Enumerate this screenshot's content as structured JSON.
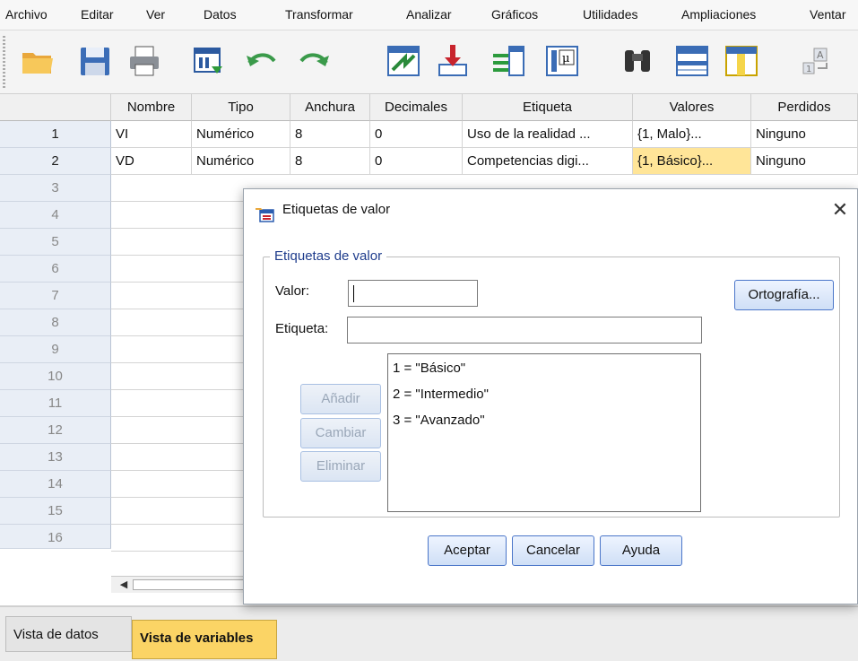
{
  "menu": [
    "Archivo",
    "Editar",
    "Ver",
    "Datos",
    "Transformar",
    "Analizar",
    "Gráficos",
    "Utilidades",
    "Ampliaciones",
    "Ventar"
  ],
  "toolbar_icons": [
    "open-folder-icon",
    "save-disk-icon",
    "print-icon",
    "dialog-recall-icon",
    "undo-icon",
    "redo-icon",
    "go-to-case-icon",
    "go-to-variable-icon",
    "variables-icon",
    "run-descriptives-icon",
    "find-icon",
    "insert-cases-icon",
    "insert-variable-icon",
    "value-labels-icon"
  ],
  "grid": {
    "columns": [
      "Nombre",
      "Tipo",
      "Anchura",
      "Decimales",
      "Etiqueta",
      "Valores",
      "Perdidos"
    ],
    "rows": [
      [
        "VI",
        "Numérico",
        "8",
        "0",
        "Uso de la realidad ...",
        "{1, Malo}...",
        "Ninguno"
      ],
      [
        "VD",
        "Numérico",
        "8",
        "0",
        "Competencias digi...",
        "{1, Básico}...",
        "Ninguno"
      ]
    ],
    "row_numbers": [
      "1",
      "2",
      "3",
      "4",
      "5",
      "6",
      "7",
      "8",
      "9",
      "10",
      "11",
      "12",
      "13",
      "14",
      "15",
      "16"
    ]
  },
  "tabs": {
    "data_view": "Vista de datos",
    "variable_view": "Vista de variables"
  },
  "dialog": {
    "title": "Etiquetas de valor",
    "close": "✕",
    "group_label": "Etiquetas de valor",
    "value_label": "Valor:",
    "value_input": "",
    "label_label": "Etiqueta:",
    "label_input": "",
    "spelling_button": "Ortografía...",
    "add_button": "Añadir",
    "change_button": "Cambiar",
    "remove_button": "Eliminar",
    "list": [
      "1 = \"Básico\"",
      "2 = \"Intermedio\"",
      "3 = \"Avanzado\""
    ],
    "ok_button": "Aceptar",
    "cancel_button": "Cancelar",
    "help_button": "Ayuda"
  },
  "colors": {
    "selected_cell": "#ffe598",
    "active_tab": "#fbd465",
    "group_label": "#1e3c8c"
  }
}
